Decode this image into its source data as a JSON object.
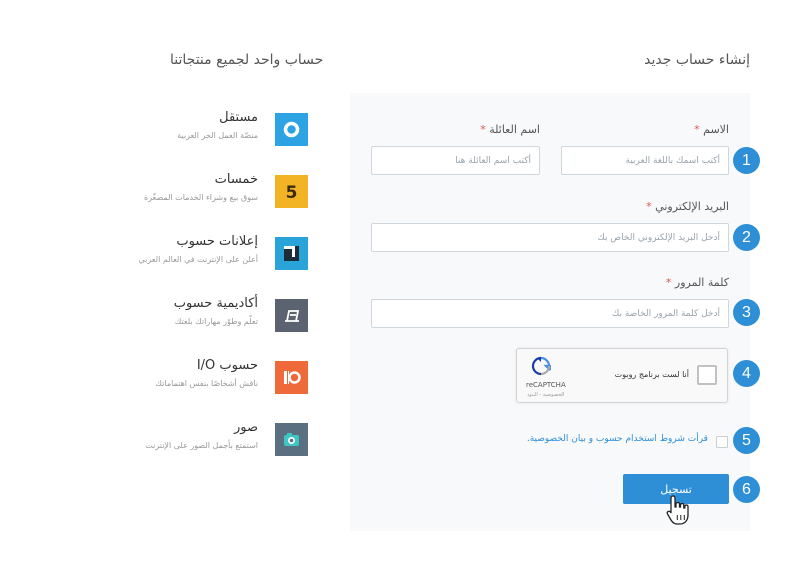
{
  "page": {
    "title": "إنشاء حساب جديد",
    "products_title": "حساب واحد لجميع منتجاتنا"
  },
  "form": {
    "first_name": {
      "label": "الاسم",
      "required": "*",
      "placeholder": "أكتب اسمك باللغة العربية"
    },
    "last_name": {
      "label": "اسم العائلة",
      "required": "*",
      "placeholder": "أكتب اسم العائلة هنا"
    },
    "email": {
      "label": "البريد الإلكتروني",
      "required": "*",
      "placeholder": "أدخل البريد الإلكتروني الخاص بك"
    },
    "password": {
      "label": "كلمة المرور",
      "required": "*",
      "placeholder": "أدخل كلمة المرور الخاصة بك"
    },
    "captcha": {
      "text": "أنا لست برنامج روبوت",
      "brand": "reCAPTCHA",
      "links": "الخصوصية - البنود"
    },
    "terms": "قرأت شروط استخدام حسوب و بيان الخصوصية.",
    "submit": "تسجيل"
  },
  "steps": [
    "1",
    "2",
    "3",
    "4",
    "5",
    "6"
  ],
  "products": [
    {
      "name": "مستقل",
      "desc": "منصّة العمل الحر العربية",
      "icon": "mostaql-icon",
      "color": "#2ea3e3"
    },
    {
      "name": "خمسات",
      "desc": "سوق بيع وشراء الخدمات المصغّرة",
      "icon": "khamsat-icon",
      "color": "#f2b324"
    },
    {
      "name": "إعلانات حسوب",
      "desc": "أعلن على الإنترنت في العالم العربي",
      "icon": "ads-icon",
      "color": "#2aa3d8"
    },
    {
      "name": "أكاديمية حسوب",
      "desc": "تعلّم وطوّر مهاراتك بلغتك",
      "icon": "academy-icon",
      "color": "#5b6370"
    },
    {
      "name": "حسوب I/O",
      "desc": "ناقش أشخاصًا بنفس اهتماماتك",
      "icon": "io-icon",
      "color": "#ee6a3a"
    },
    {
      "name": "صور",
      "desc": "استمتع بأجمل الصور على الإنترنت",
      "icon": "sowar-icon",
      "color": "#5a6f80"
    }
  ]
}
